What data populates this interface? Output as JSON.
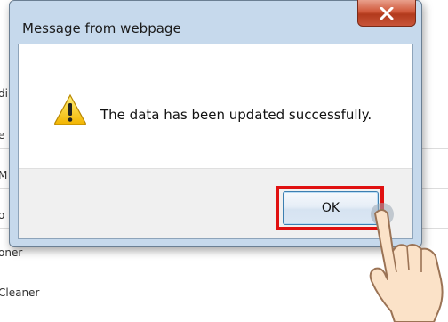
{
  "background": {
    "rows": [
      {
        "label": "di"
      },
      {
        "label": "e"
      },
      {
        "label": "M"
      },
      {
        "label": "o"
      },
      {
        "label": "oner"
      },
      {
        "label": "Cleaner"
      }
    ]
  },
  "dialog": {
    "title": "Message from webpage",
    "close_label": "X",
    "message": "The data has been updated successfully.",
    "ok_label": "OK",
    "icon": "warning-icon"
  },
  "colors": {
    "highlight": "#e01010",
    "close_button": "#c8553a",
    "frame": "#c6d9ec"
  }
}
